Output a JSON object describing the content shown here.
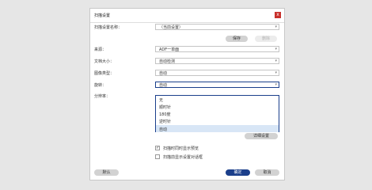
{
  "dialog": {
    "title": "扫描设置",
    "close_glyph": "x"
  },
  "profile": {
    "label": "扫描设置名称：",
    "value": "（当前设置）"
  },
  "buttons": {
    "save": "保存",
    "delete": "删除",
    "detail": "详细设置",
    "default": "默认",
    "ok": "确定",
    "cancel": "取消"
  },
  "fields": {
    "source": {
      "label": "来源：",
      "value": "ADF一单面"
    },
    "doc_size": {
      "label": "文档大小：",
      "value": "自动检测"
    },
    "image_type": {
      "label": "图像类型：",
      "value": "自动"
    },
    "rotate": {
      "label": "旋转：",
      "value": "自动"
    },
    "output": {
      "label": "分辨率："
    }
  },
  "rotate_options": [
    {
      "label": "无",
      "selected": false
    },
    {
      "label": "顺时针",
      "selected": false
    },
    {
      "label": "180度",
      "selected": false
    },
    {
      "label": "逆时针",
      "selected": false
    },
    {
      "label": "自动",
      "selected": true
    }
  ],
  "checkboxes": [
    {
      "label": "扫描时同时显示预览",
      "checked": true
    },
    {
      "label": "扫描前显示设置对话框",
      "checked": false
    }
  ],
  "icons": {
    "dropdown_arrow": "▾",
    "checkmark": "✓"
  }
}
